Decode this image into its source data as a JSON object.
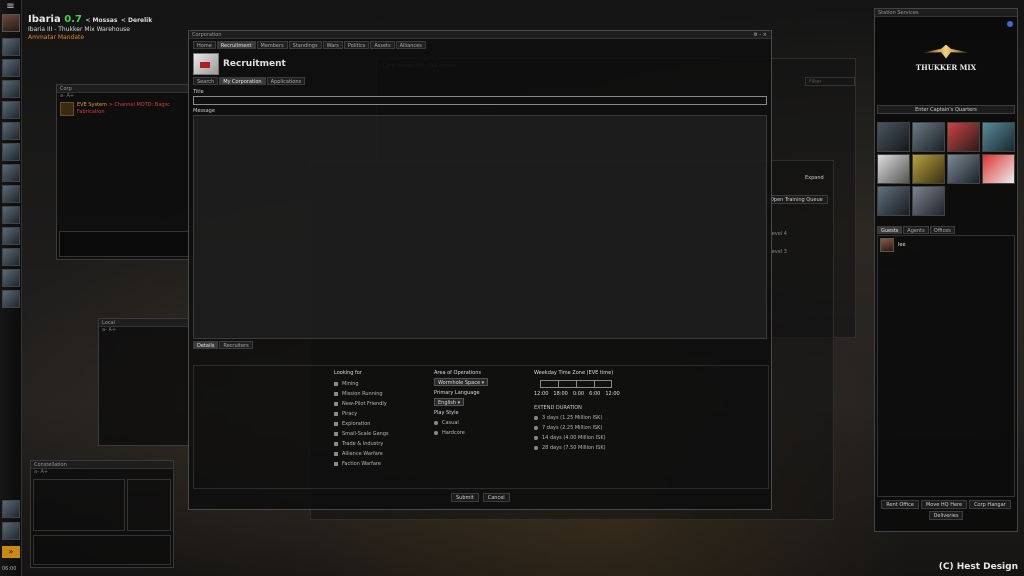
{
  "location": {
    "system": "Ibaria",
    "security": "0.7",
    "constellation": "Mossas",
    "region": "Derelik",
    "station": "Ibaria III - Thukker Mix Warehouse",
    "sovereignty": "Ammatar Mandate"
  },
  "clock": "06:00",
  "corp_chat": {
    "title": "Corp",
    "font_tools": "a- A+",
    "message_sender": "EVE System",
    "message_text": "> Channel MOTD: Bagsc",
    "message_text2": "Fabrication"
  },
  "local_chat": {
    "title": "Local",
    "font_tools": "a- A+"
  },
  "constellation_chat": {
    "title": "Constellation",
    "font_tools": "a- A+"
  },
  "corporation_window": {
    "title": "Corporation",
    "controls": "⚙ - ×",
    "tabs": [
      "Home",
      "Recruitment",
      "Members",
      "Standings",
      "Wars",
      "Politics",
      "Assets",
      "Alliances"
    ],
    "section_title": "Recruitment",
    "subtabs": [
      "Search",
      "My Corporation",
      "Applications"
    ],
    "title_label": "Title",
    "title_value": "",
    "message_label": "Message",
    "bottom_tabs": [
      "Details",
      "Recruiters"
    ],
    "looking_for_label": "Looking for",
    "looking_for_options": [
      "Mining",
      "Mission Running",
      "New-Pilot Friendly",
      "Piracy",
      "Exploration",
      "Small-Scale Gangs",
      "Trade & Industry",
      "Alliance Warfare",
      "Faction Warfare"
    ],
    "area_label": "Area of Operations",
    "area_value": "Wormhole Space",
    "language_label": "Primary Language",
    "language_value": "English",
    "playstyle_label": "Play Style",
    "playstyle_options": [
      "Casual",
      "Hardcore"
    ],
    "timezone_label": "Weekday Time Zone (EVE time)",
    "timezone_ticks": [
      "12:00",
      "18:00",
      "0:00",
      "6:00",
      "12:00"
    ],
    "extend_label": "EXTEND DURATION",
    "durations": [
      "3 days (1.25 Million ISK)",
      "7 days (2.25 Million ISK)",
      "14 days (4.00 Million ISK)",
      "28 days (7.50 Million ISK)"
    ],
    "submit": "Submit",
    "cancel": "Cancel"
  },
  "background_window": {
    "hangar_title": "Corp Hangar (N) - Full access",
    "filter_placeholder": "Filter",
    "expand": "Expand",
    "training_queue": "Open Training Queue",
    "skill_level_1": "Level 4",
    "skill_level_2": "Level 3"
  },
  "station_services": {
    "title": "Station Services",
    "logo_text": "THUKKER MIX",
    "quarters_button": "Enter Captain's Quarters",
    "service_icons": [
      "agent-icon",
      "repair-icon",
      "medical-icon",
      "fitting-icon",
      "market-icon",
      "reprocessing-icon",
      "industry-icon",
      "insurance-icon",
      "clone-icon",
      "hangar-icon"
    ],
    "guest_tabs": [
      "Guests",
      "Agents",
      "Offices"
    ],
    "guest_name": "lee",
    "buttons": [
      "Rent Office",
      "Move HQ Here",
      "Corp Hangar",
      "Deliveries"
    ]
  },
  "watermark": "(C) Hest Design"
}
